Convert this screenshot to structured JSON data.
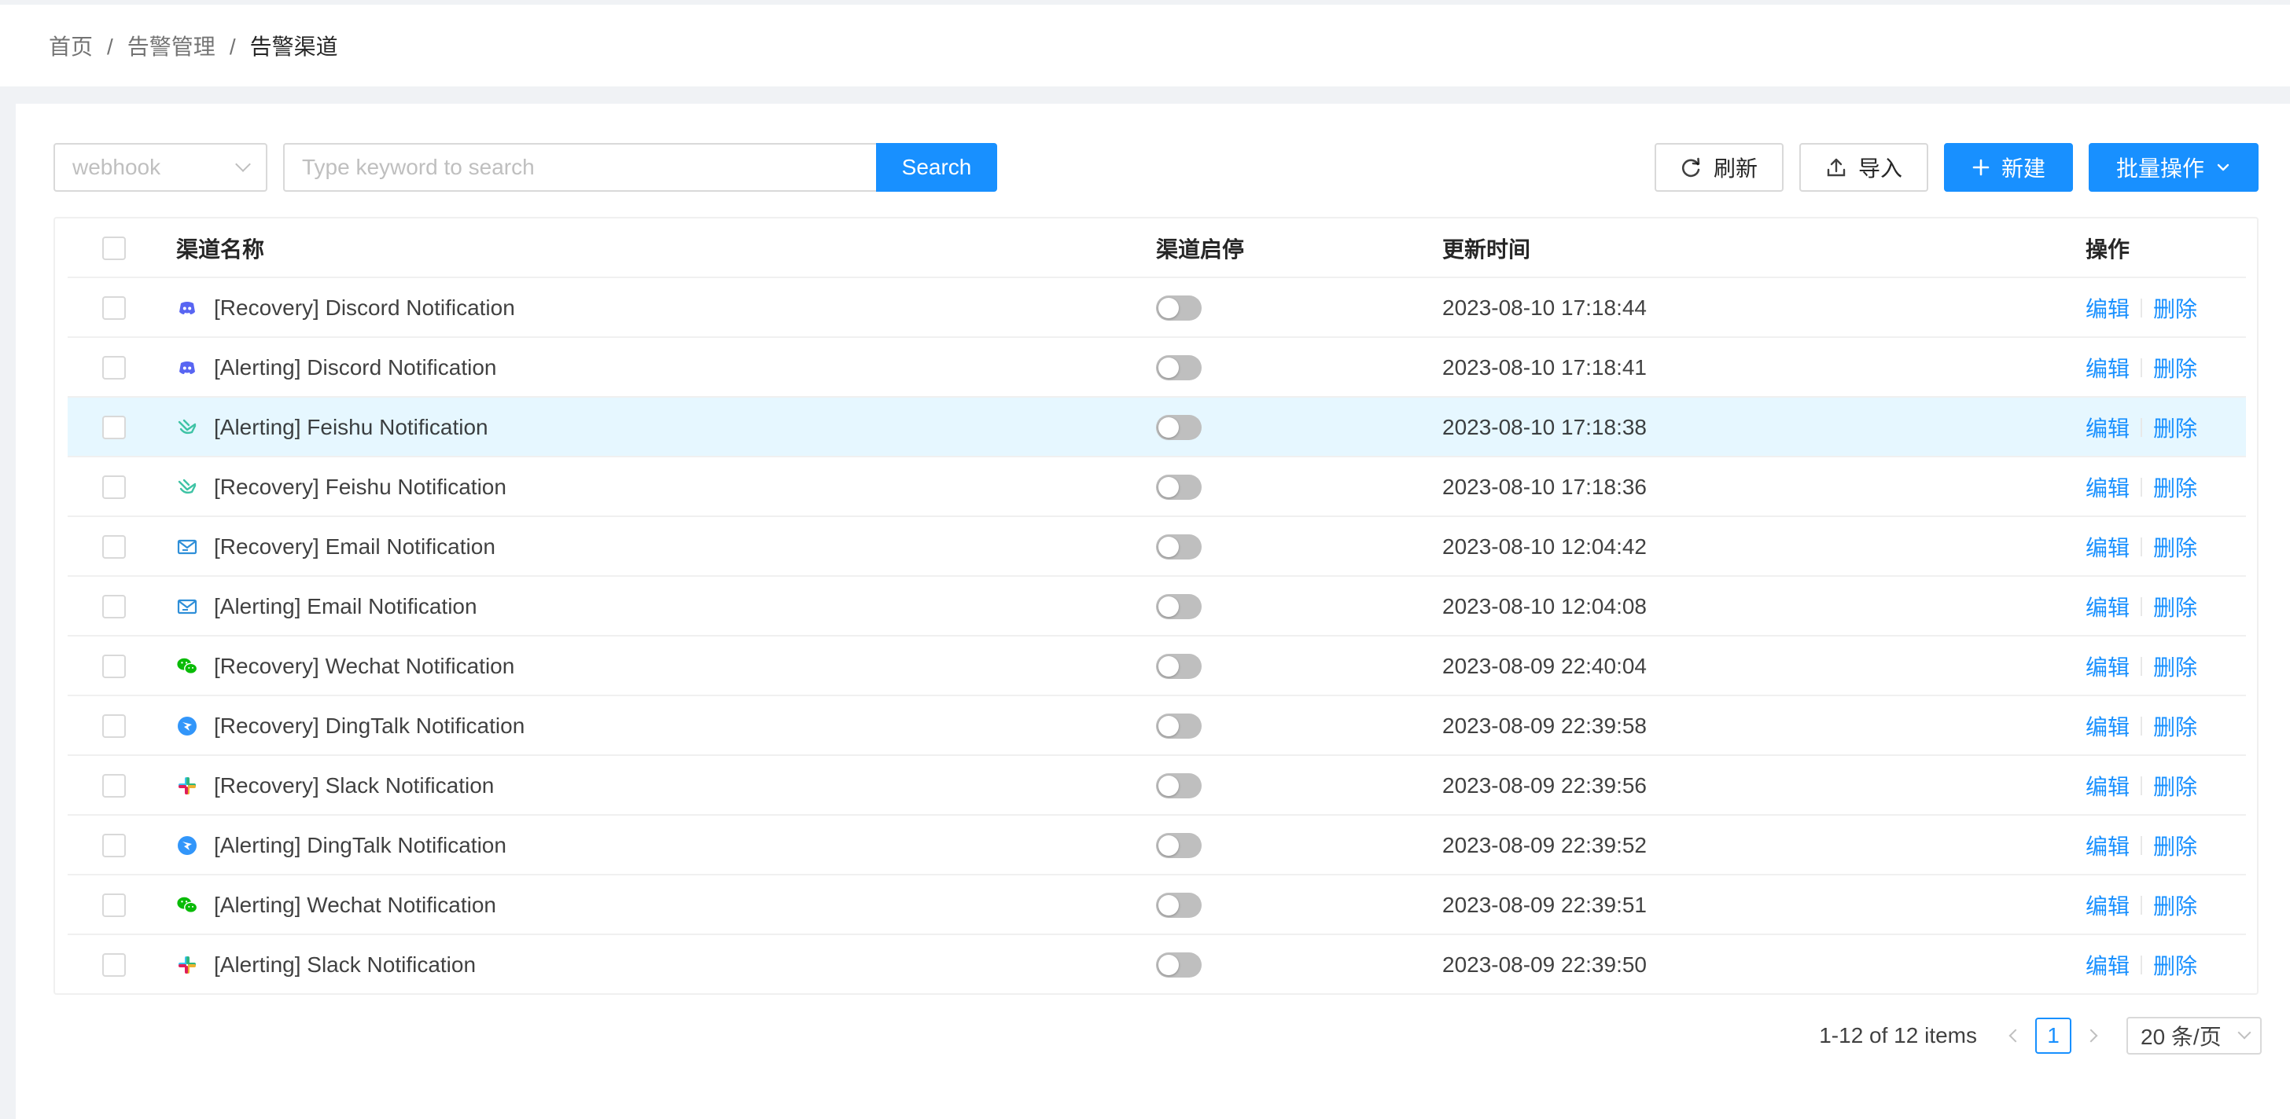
{
  "breadcrumb": [
    "首页",
    "告警管理",
    "告警渠道"
  ],
  "breadcrumb_sep": "/",
  "toolbar": {
    "filter_value": "webhook",
    "search_placeholder": "Type keyword to search",
    "search_label": "Search",
    "refresh_label": "刷新",
    "import_label": "导入",
    "new_label": "新建",
    "batch_label": "批量操作"
  },
  "table": {
    "columns": [
      "渠道名称",
      "渠道启停",
      "更新时间",
      "操作"
    ],
    "rows": [
      {
        "icon": "discord-icon",
        "name": "[Recovery] Discord Notification",
        "time": "2023-08-10 17:18:44",
        "enabled": false
      },
      {
        "icon": "discord-icon",
        "name": "[Alerting] Discord Notification",
        "time": "2023-08-10 17:18:41",
        "enabled": false
      },
      {
        "icon": "feishu-icon",
        "name": "[Alerting] Feishu Notification",
        "time": "2023-08-10 17:18:38",
        "enabled": false
      },
      {
        "icon": "feishu-icon",
        "name": "[Recovery] Feishu Notification",
        "time": "2023-08-10 17:18:36",
        "enabled": false
      },
      {
        "icon": "email-icon",
        "name": "[Recovery] Email Notification",
        "time": "2023-08-10 12:04:42",
        "enabled": false
      },
      {
        "icon": "email-icon",
        "name": "[Alerting] Email Notification",
        "time": "2023-08-10 12:04:08",
        "enabled": false
      },
      {
        "icon": "wechat-icon",
        "name": "[Recovery] Wechat Notification",
        "time": "2023-08-09 22:40:04",
        "enabled": false
      },
      {
        "icon": "dingtalk-icon",
        "name": "[Recovery] DingTalk Notification",
        "time": "2023-08-09 22:39:58",
        "enabled": false
      },
      {
        "icon": "slack-icon",
        "name": "[Recovery] Slack Notification",
        "time": "2023-08-09 22:39:56",
        "enabled": false
      },
      {
        "icon": "dingtalk-icon",
        "name": "[Alerting] DingTalk Notification",
        "time": "2023-08-09 22:39:52",
        "enabled": false
      },
      {
        "icon": "wechat-icon",
        "name": "[Alerting] Wechat Notification",
        "time": "2023-08-09 22:39:51",
        "enabled": false
      },
      {
        "icon": "slack-icon",
        "name": "[Alerting] Slack Notification",
        "time": "2023-08-09 22:39:50",
        "enabled": false
      }
    ],
    "edit_label": "编辑",
    "delete_label": "删除"
  },
  "pagination": {
    "total_text": "1-12 of 12 items",
    "current_page": "1",
    "page_size": "20 条/页"
  },
  "colors": {
    "primary": "#1890ff",
    "highlight_row": "#e6f7ff",
    "discord": "#5865f2",
    "feishu": "#3fc3a5",
    "email": "#2f8fd8",
    "wechat": "#09bb07",
    "dingtalk": "#3296fa"
  }
}
